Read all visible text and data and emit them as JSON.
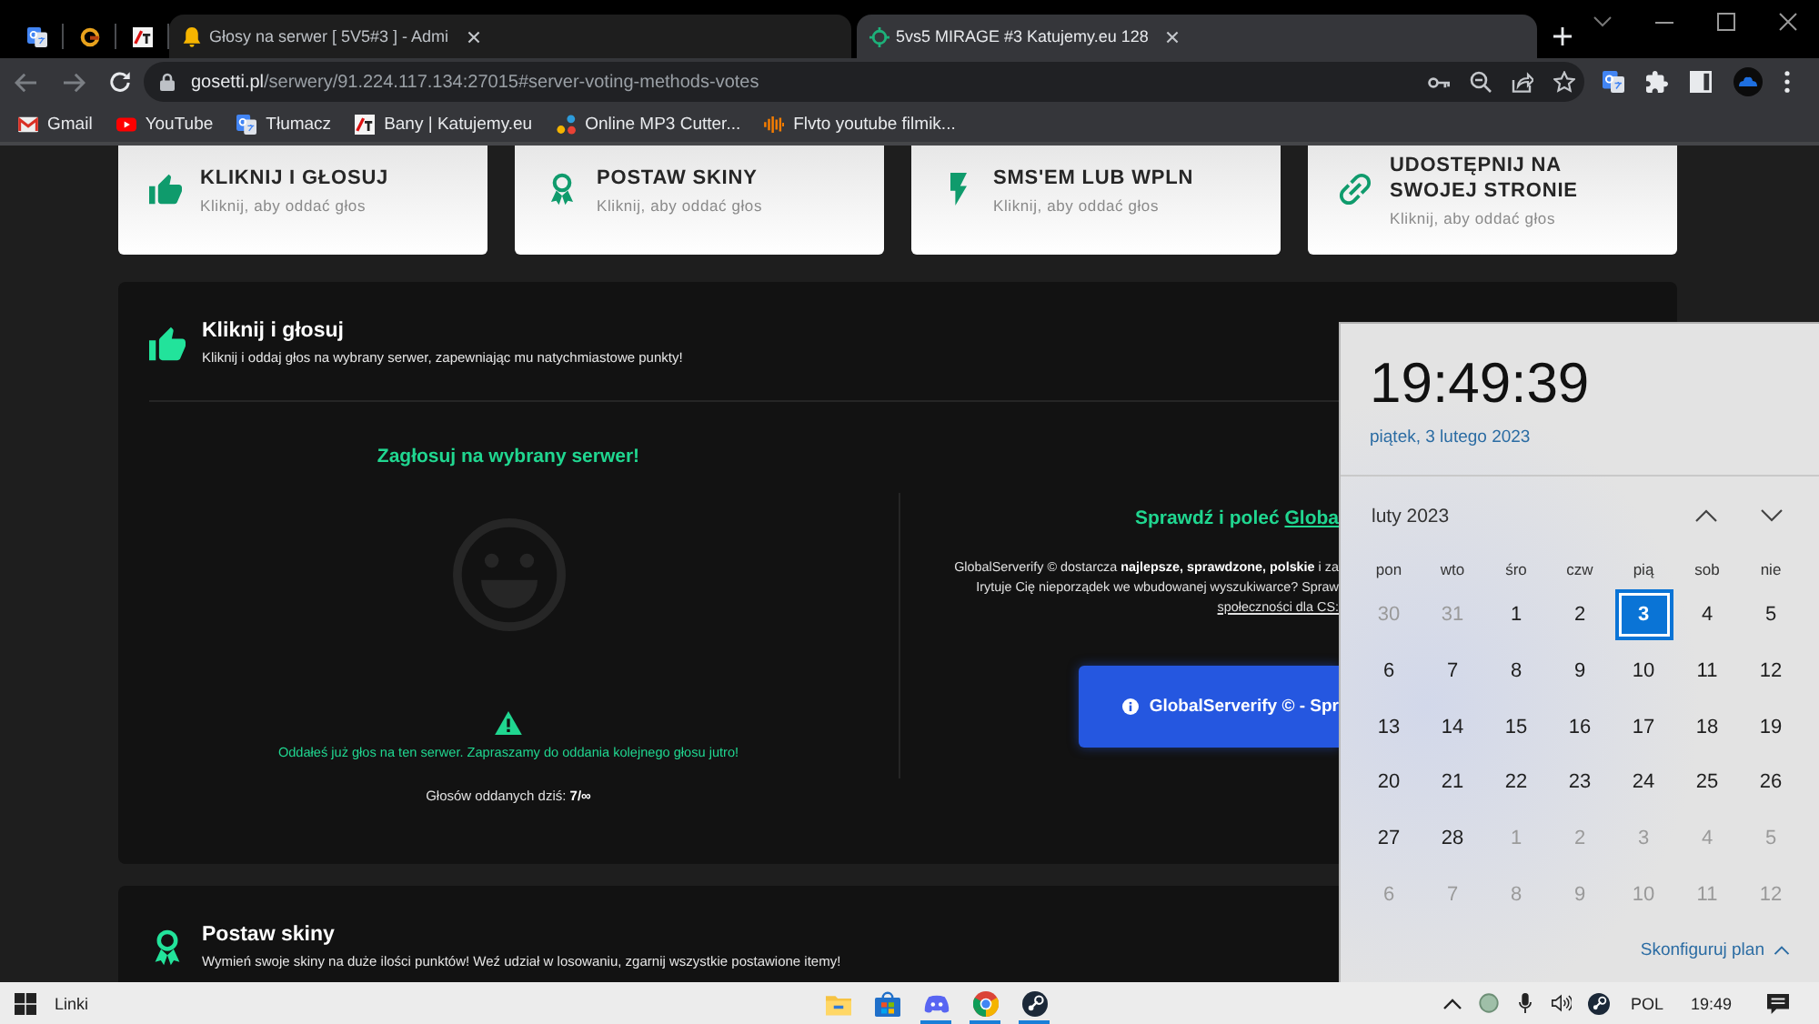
{
  "browser": {
    "tabs": [
      {
        "kind": "pinned",
        "selected": false
      },
      {
        "kind": "pinned",
        "selected": false
      },
      {
        "kind": "pinned",
        "selected": false
      },
      {
        "kind": "page",
        "title": "Głosy na serwer [ 5V5#3 ] - Admi",
        "selected": false
      },
      {
        "kind": "page",
        "title": "5vs5 MIRAGE #3 Katujemy.eu 128",
        "selected": true
      }
    ],
    "address": {
      "host": "gosetti.pl",
      "path": "/serwery/91.224.117.134:27015#server-voting-methods-votes"
    },
    "bookmarks": [
      {
        "label": "Gmail"
      },
      {
        "label": "YouTube"
      },
      {
        "label": "Tłumacz"
      },
      {
        "label": "Bany | Katujemy.eu"
      },
      {
        "label": "Online MP3 Cutter..."
      },
      {
        "label": "Flvto youtube filmik..."
      }
    ]
  },
  "page": {
    "method_cards": [
      {
        "title": "KLIKNIJ I GŁOSUJ",
        "subtitle": "Kliknij, aby oddać głos"
      },
      {
        "title": "POSTAW SKINY",
        "subtitle": "Kliknij, aby oddać głos"
      },
      {
        "title": "SMS'EM LUB WPLN",
        "subtitle": "Kliknij, aby oddać głos"
      },
      {
        "title": "UDOSTĘPNIJ NA SWOJEJ STRONIE",
        "subtitle": "Kliknij, aby oddać głos"
      }
    ],
    "vote_section": {
      "title": "Kliknij i głosuj",
      "subtitle": "Kliknij i oddaj głos na wybrany serwer, zapewniając mu natychmiastowe punkty!",
      "vote_heading": "Zagłosuj na wybrany serwer!",
      "notice": "Oddałeś już głos na ten serwer. Zapraszamy do oddania kolejnego głosu jutro!",
      "votes_today": "Głosów oddanych dziś: **7/∞**",
      "promo_heading": "Sprawdź i poleć",
      "promo_link": "Globa",
      "promo_lines": [
        {
          "kind": "text",
          "text": "GlobalServerify © dostarcza **najlepsze, sprawdzone, polskie** i za"
        },
        {
          "kind": "text",
          "text": "Irytuje Cię nieporządek we wbudowanej wyszukiwarce? Spraw"
        },
        {
          "kind": "link",
          "text": "społeczności dla CS:"
        }
      ],
      "promo_button": "GlobalServerify © - Spr"
    },
    "skins_section": {
      "title": "Postaw skiny",
      "subtitle": "Wymień swoje skiny na duże ilości punktów! Weź udział w losowaniu, zgarnij wszystkie postawione itemy!"
    }
  },
  "calendar": {
    "time": "19:49:39",
    "date": "piątek, 3 lutego 2023",
    "month": "luty 2023",
    "weekdays": [
      "pon",
      "wto",
      "śro",
      "czw",
      "pią",
      "sob",
      "nie"
    ],
    "days": [
      {
        "label": "30",
        "other_month": true,
        "selected": false
      },
      {
        "label": "31",
        "other_month": true,
        "selected": false
      },
      {
        "label": "1",
        "other_month": false,
        "selected": false
      },
      {
        "label": "2",
        "other_month": false,
        "selected": false
      },
      {
        "label": "3",
        "other_month": false,
        "selected": true
      },
      {
        "label": "4",
        "other_month": false,
        "selected": false
      },
      {
        "label": "5",
        "other_month": false,
        "selected": false
      },
      {
        "label": "6",
        "other_month": false,
        "selected": false
      },
      {
        "label": "7",
        "other_month": false,
        "selected": false
      },
      {
        "label": "8",
        "other_month": false,
        "selected": false
      },
      {
        "label": "9",
        "other_month": false,
        "selected": false
      },
      {
        "label": "10",
        "other_month": false,
        "selected": false
      },
      {
        "label": "11",
        "other_month": false,
        "selected": false
      },
      {
        "label": "12",
        "other_month": false,
        "selected": false
      },
      {
        "label": "13",
        "other_month": false,
        "selected": false
      },
      {
        "label": "14",
        "other_month": false,
        "selected": false
      },
      {
        "label": "15",
        "other_month": false,
        "selected": false
      },
      {
        "label": "16",
        "other_month": false,
        "selected": false
      },
      {
        "label": "17",
        "other_month": false,
        "selected": false
      },
      {
        "label": "18",
        "other_month": false,
        "selected": false
      },
      {
        "label": "19",
        "other_month": false,
        "selected": false
      },
      {
        "label": "20",
        "other_month": false,
        "selected": false
      },
      {
        "label": "21",
        "other_month": false,
        "selected": false
      },
      {
        "label": "22",
        "other_month": false,
        "selected": false
      },
      {
        "label": "23",
        "other_month": false,
        "selected": false
      },
      {
        "label": "24",
        "other_month": false,
        "selected": false
      },
      {
        "label": "25",
        "other_month": false,
        "selected": false
      },
      {
        "label": "26",
        "other_month": false,
        "selected": false
      },
      {
        "label": "27",
        "other_month": false,
        "selected": false
      },
      {
        "label": "28",
        "other_month": false,
        "selected": false
      },
      {
        "label": "1",
        "other_month": true,
        "selected": false
      },
      {
        "label": "2",
        "other_month": true,
        "selected": false
      },
      {
        "label": "3",
        "other_month": true,
        "selected": false
      },
      {
        "label": "4",
        "other_month": true,
        "selected": false
      },
      {
        "label": "5",
        "other_month": true,
        "selected": false
      },
      {
        "label": "6",
        "other_month": true,
        "selected": false
      },
      {
        "label": "7",
        "other_month": true,
        "selected": false
      },
      {
        "label": "8",
        "other_month": true,
        "selected": false
      },
      {
        "label": "9",
        "other_month": true,
        "selected": false
      },
      {
        "label": "10",
        "other_month": true,
        "selected": false
      },
      {
        "label": "11",
        "other_month": true,
        "selected": false
      },
      {
        "label": "12",
        "other_month": true,
        "selected": false
      }
    ],
    "footer_link": "Skonfiguruj plan"
  },
  "taskbar": {
    "label": "Linki",
    "apps": [
      {
        "running": false
      },
      {
        "running": false
      },
      {
        "running": true
      },
      {
        "running": true
      },
      {
        "running": true
      }
    ],
    "language": "POL",
    "time": "19:49"
  }
}
